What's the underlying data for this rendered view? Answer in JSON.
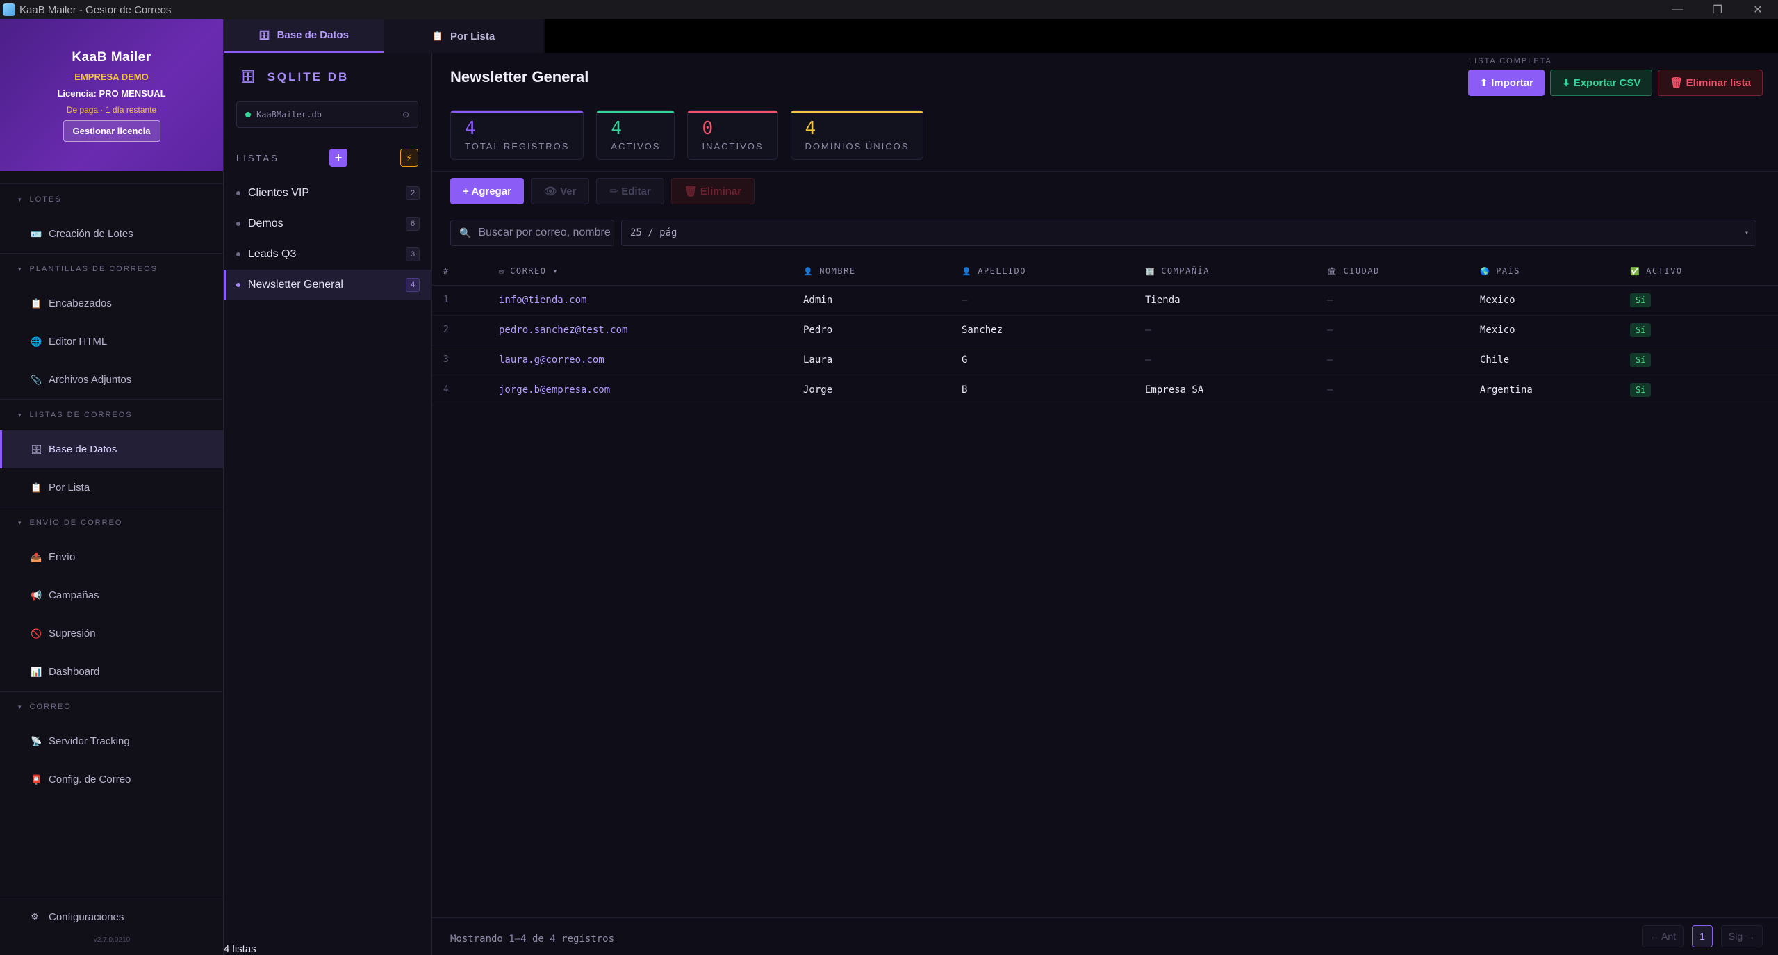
{
  "window": {
    "title": "KaaB Mailer - Gestor de Correos"
  },
  "license": {
    "brand": "KaaB Mailer",
    "company": "EMPRESA DEMO",
    "plan": "Licencia: PRO MENSUAL",
    "remaining": "De paga · 1 día restante",
    "manage_label": "Gestionar licencia"
  },
  "nav": {
    "sections": [
      {
        "header": "LOTES",
        "items": [
          {
            "label": "Creación de Lotes",
            "icon": "🪪"
          }
        ]
      },
      {
        "header": "PLANTILLAS DE CORREOS",
        "items": [
          {
            "label": "Encabezados",
            "icon": "📋"
          },
          {
            "label": "Editor HTML",
            "icon": "🌐"
          },
          {
            "label": "Archivos Adjuntos",
            "icon": "📎"
          }
        ]
      },
      {
        "header": "LISTAS DE CORREOS",
        "items": [
          {
            "label": "Base de Datos",
            "icon": "🗄"
          },
          {
            "label": "Por Lista",
            "icon": "📋"
          }
        ]
      },
      {
        "header": "ENVÍO DE CORREO",
        "items": [
          {
            "label": "Envío",
            "icon": "📤"
          },
          {
            "label": "Campañas",
            "icon": "📢"
          },
          {
            "label": "Supresión",
            "icon": "🚫"
          },
          {
            "label": "Dashboard",
            "icon": "📊"
          }
        ]
      },
      {
        "header": "CORREO",
        "items": [
          {
            "label": "Servidor Tracking",
            "icon": "📡"
          },
          {
            "label": "Config. de Correo",
            "icon": "📮"
          }
        ]
      }
    ],
    "settings_label": "Configuraciones",
    "version": "v2.7.0.0210"
  },
  "tabs": [
    {
      "label": "Base de Datos",
      "icon": "🗄"
    },
    {
      "label": "Por Lista",
      "icon": "📋"
    }
  ],
  "db": {
    "title": "SQLITE DB",
    "file": "KaaBMailer.db",
    "lists_header": "LISTAS",
    "lists": [
      {
        "name": "Clientes VIP",
        "count": "2"
      },
      {
        "name": "Demos",
        "count": "6"
      },
      {
        "name": "Leads Q3",
        "count": "3"
      },
      {
        "name": "Newsletter General",
        "count": "4"
      }
    ],
    "footer": "4 listas"
  },
  "main": {
    "title": "Newsletter General",
    "overline": "LISTA COMPLETA",
    "actions": {
      "import": "⬆ Importar",
      "export": "⬇ Exportar CSV",
      "delete_list": "🗑 Eliminar lista"
    },
    "stats": [
      {
        "value": "4",
        "label": "TOTAL REGISTROS",
        "color": "#8b5cf6"
      },
      {
        "value": "4",
        "label": "ACTIVOS",
        "color": "#34d399"
      },
      {
        "value": "0",
        "label": "INACTIVOS",
        "color": "#f0526a"
      },
      {
        "value": "4",
        "label": "DOMINIOS ÚNICOS",
        "color": "#f5c542"
      }
    ],
    "toolbar": {
      "add": "+ Agregar",
      "view": "👁 Ver",
      "edit": "✏ Editar",
      "delete": "🗑 Eliminar"
    },
    "search_placeholder": "Buscar por correo, nombre...",
    "per_page": "25 / pág",
    "columns": [
      {
        "label": "#",
        "icon": ""
      },
      {
        "label": "CORREO ▾",
        "icon": "✉"
      },
      {
        "label": "NOMBRE",
        "icon": "👤"
      },
      {
        "label": "APELLIDO",
        "icon": "👤"
      },
      {
        "label": "COMPAÑÍA",
        "icon": "🏢"
      },
      {
        "label": "CIUDAD",
        "icon": "🏛"
      },
      {
        "label": "PAÍS",
        "icon": "🌎"
      },
      {
        "label": "ACTIVO",
        "icon": "✅"
      }
    ],
    "rows": [
      {
        "n": "1",
        "email": "info@tienda.com",
        "first": "Admin",
        "last": "—",
        "company": "Tienda",
        "city": "—",
        "country": "Mexico",
        "active": "Sí"
      },
      {
        "n": "2",
        "email": "pedro.sanchez@test.com",
        "first": "Pedro",
        "last": "Sanchez",
        "company": "—",
        "city": "—",
        "country": "Mexico",
        "active": "Sí"
      },
      {
        "n": "3",
        "email": "laura.g@correo.com",
        "first": "Laura",
        "last": "G",
        "company": "—",
        "city": "—",
        "country": "Chile",
        "active": "Sí"
      },
      {
        "n": "4",
        "email": "jorge.b@empresa.com",
        "first": "Jorge",
        "last": "B",
        "company": "Empresa SA",
        "city": "—",
        "country": "Argentina",
        "active": "Sí"
      }
    ],
    "showing": "Mostrando 1–4 de 4 registros",
    "pager": {
      "prev": "← Ant",
      "current": "1",
      "next": "Sig →"
    }
  }
}
